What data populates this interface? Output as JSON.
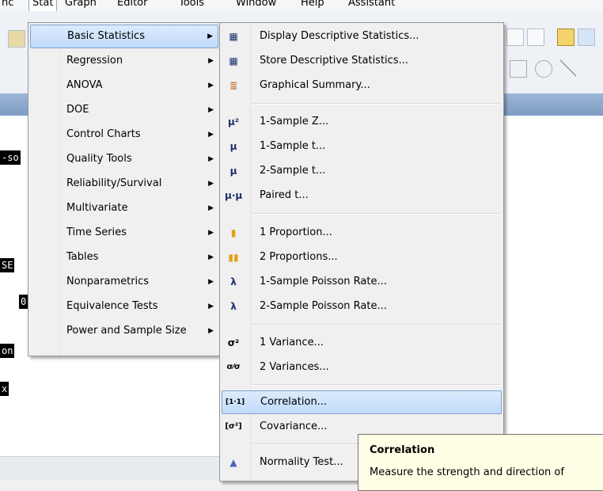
{
  "menubar": {
    "items": [
      "nc",
      "Stat",
      "Graph",
      "Editor",
      "Tools",
      "Window",
      "Help",
      "Assistant"
    ]
  },
  "session": {
    "fragments": [
      "-so",
      "SE",
      "0",
      "on",
      "x"
    ]
  },
  "stat_menu": {
    "items": [
      {
        "label": "Basic Statistics",
        "highlighted": true
      },
      {
        "label": "Regression"
      },
      {
        "label": "ANOVA"
      },
      {
        "label": "DOE"
      },
      {
        "label": "Control Charts"
      },
      {
        "label": "Quality Tools"
      },
      {
        "label": "Reliability/Survival"
      },
      {
        "label": "Multivariate"
      },
      {
        "label": "Time Series"
      },
      {
        "label": "Tables"
      },
      {
        "label": "Nonparametrics"
      },
      {
        "label": "Equivalence Tests"
      },
      {
        "label": "Power and Sample Size"
      }
    ]
  },
  "basic_stats_menu": {
    "items": [
      {
        "label": "Display Descriptive Statistics...",
        "icon": "table-sigma-icon",
        "glyph": "▦"
      },
      {
        "label": "Store Descriptive Statistics...",
        "icon": "table-store-icon",
        "glyph": "▦"
      },
      {
        "label": "Graphical Summary...",
        "icon": "summary-icon",
        "glyph": "≣"
      },
      {
        "label": "1-Sample Z...",
        "icon": "mu-squared-icon",
        "glyph": "μ²"
      },
      {
        "label": "1-Sample t...",
        "icon": "mu-icon",
        "glyph": "μ"
      },
      {
        "label": "2-Sample t...",
        "icon": "mu-two-icon",
        "glyph": "μ"
      },
      {
        "label": "Paired t...",
        "icon": "mu-mu-icon",
        "glyph": "μ·μ"
      },
      {
        "label": "1 Proportion...",
        "icon": "proportion-icon",
        "glyph": "▮"
      },
      {
        "label": "2 Proportions...",
        "icon": "proportions-icon",
        "glyph": "▮▮"
      },
      {
        "label": "1-Sample Poisson Rate...",
        "icon": "lambda-icon",
        "glyph": "λ"
      },
      {
        "label": "2-Sample Poisson Rate...",
        "icon": "lambda-two-icon",
        "glyph": "λ"
      },
      {
        "label": "1 Variance...",
        "icon": "sigma-squared-icon",
        "glyph": "σ²"
      },
      {
        "label": "2 Variances...",
        "icon": "sigma-ratio-icon",
        "glyph": "σ⁄σ"
      },
      {
        "label": "Correlation...",
        "icon": "correlation-icon",
        "glyph": "[1·1]",
        "highlighted": true
      },
      {
        "label": "Covariance...",
        "icon": "covariance-icon",
        "glyph": "[σ²]"
      },
      {
        "label": "Normality Test...",
        "icon": "normality-icon",
        "glyph": "▲"
      }
    ]
  },
  "tooltip": {
    "title": "Correlation",
    "description": "Measure the strength and direction of"
  },
  "colors": {
    "highlight_top": "#dcebfc",
    "highlight_bottom": "#c1dbfc",
    "highlight_border": "#7da2ce",
    "tooltip_bg": "#ffffe6",
    "titlebar": "#7e9cc4"
  }
}
